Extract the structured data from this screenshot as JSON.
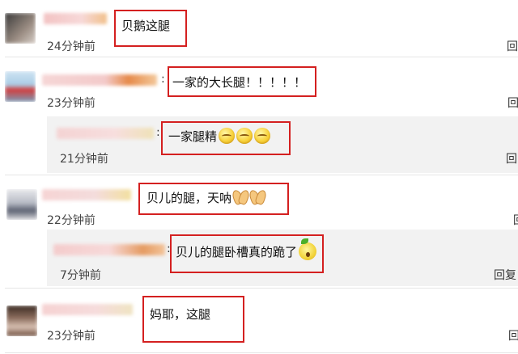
{
  "comments": [
    {
      "id": "c1",
      "text": "贝鹅这腿",
      "time": "24分钟前",
      "reply": "回"
    },
    {
      "id": "c2",
      "text": "一家的大长腿！！！！！",
      "time": "23分钟前",
      "reply": "回"
    },
    {
      "id": "c3",
      "text": "一家腿精",
      "time": "21分钟前",
      "reply": "回",
      "emoji": [
        "grin-emoji",
        "grin-emoji",
        "grin-emoji"
      ]
    },
    {
      "id": "c4",
      "text": "贝儿的腿，天呐",
      "time": "22分钟前",
      "reply": "回",
      "emoji": [
        "clap-emoji",
        "clap-emoji"
      ]
    },
    {
      "id": "c5",
      "text": "贝儿的腿卧槽真的跪了",
      "time": "7分钟前",
      "reply": "回复",
      "emoji": [
        "shocked-emoji"
      ]
    },
    {
      "id": "c6",
      "text": "妈耶，这腿",
      "time": "23分钟前",
      "reply": "回"
    }
  ],
  "colon": ":",
  "colors": {
    "highlight": "#d42020",
    "reply_bg": "#f2f2f2"
  }
}
